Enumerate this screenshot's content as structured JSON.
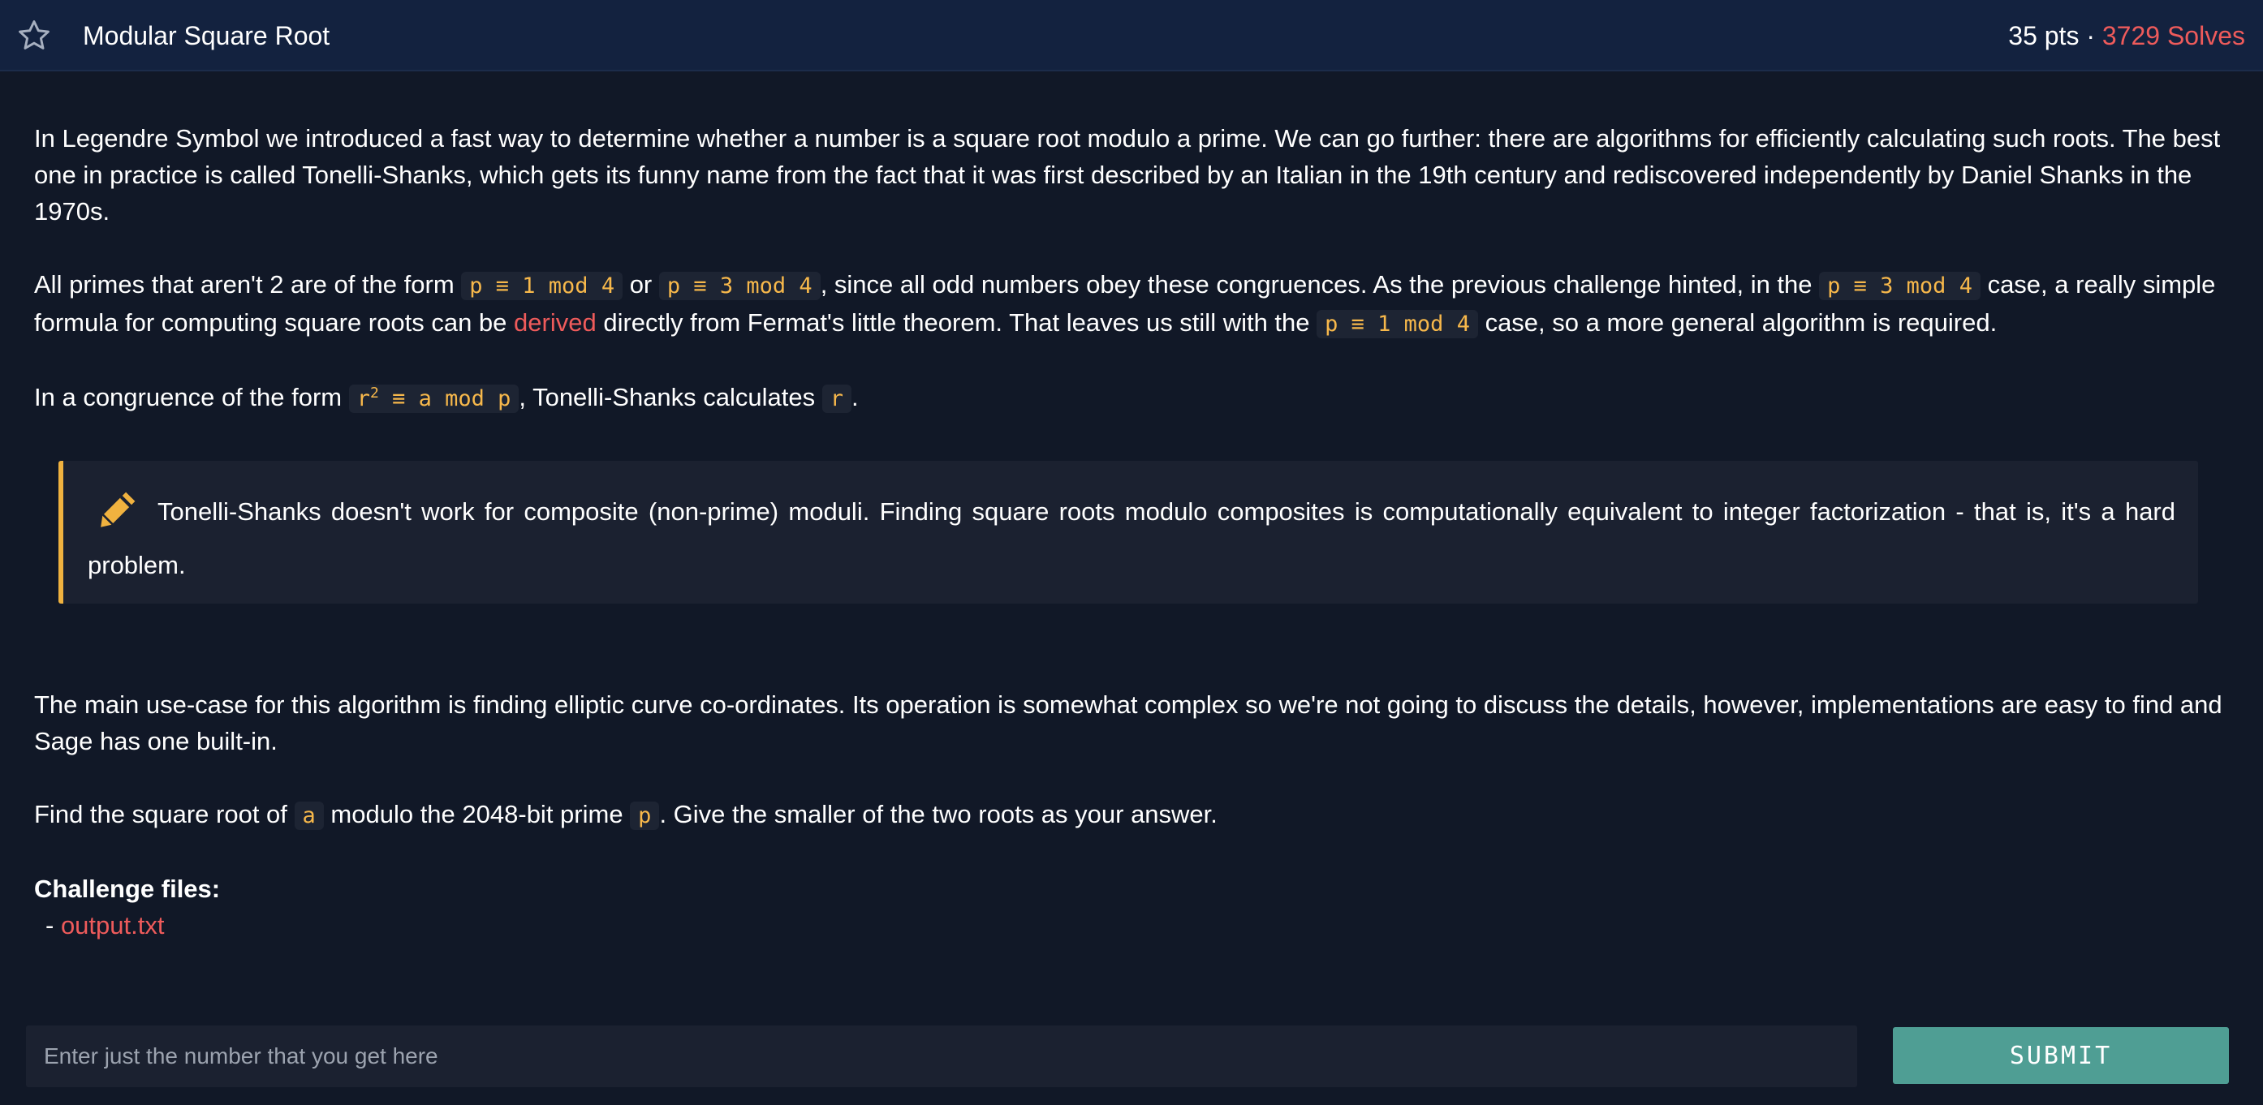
{
  "header": {
    "title": "Modular Square Root",
    "points": "35 pts",
    "separator": " · ",
    "solves": "3729 Solves"
  },
  "content": {
    "p1": "In Legendre Symbol we introduced a fast way to determine whether a number is a square root modulo a prime. We can go further: there are algorithms for efficiently calculating such roots. The best one in practice is called Tonelli-Shanks, which gets its funny name from the fact that it was first described by an Italian in the 19th century and rediscovered independently by Daniel Shanks in the 1970s.",
    "p2": {
      "t1": "All primes that aren't 2 are of the form ",
      "c1": "p ≡ 1 mod 4",
      "t2": " or ",
      "c2": "p ≡ 3 mod 4",
      "t3": ", since all odd numbers obey these congruences. As the previous challenge hinted, in the ",
      "c3": "p ≡ 3 mod 4",
      "t4": " case, a really simple formula for computing square roots can be ",
      "link": "derived",
      "t5": " directly from Fermat's little theorem. That leaves us still with the ",
      "c4": "p ≡ 1 mod 4",
      "t6": " case, so a more general algorithm is required."
    },
    "p3": {
      "t1": "In a congruence of the form ",
      "c1a": "r",
      "c1sup": "2",
      "c1b": " ≡ a mod p",
      "t2": ", Tonelli-Shanks calculates ",
      "c2": "r",
      "t3": "."
    },
    "note": "Tonelli-Shanks doesn't work for composite (non-prime) moduli. Finding square roots modulo composites is computationally equivalent to integer factorization - that is, it's a hard problem.",
    "p4": "The main use-case for this algorithm is finding elliptic curve co-ordinates. Its operation is somewhat complex so we're not going to discuss the details, however, implementations are easy to find and Sage has one built-in.",
    "p5": {
      "t1": "Find the square root of ",
      "c1": "a",
      "t2": " modulo the 2048-bit prime ",
      "c2": "p",
      "t3": ". Give the smaller of the two roots as your answer."
    },
    "files_label": "Challenge files:",
    "files": [
      {
        "bullet": "- ",
        "name": "output.txt"
      }
    ]
  },
  "form": {
    "placeholder": "Enter just the number that you get here",
    "submit_label": "SUBMIT"
  },
  "icons": {
    "star": "star-outline-icon",
    "pencil": "pencil-icon"
  },
  "colors": {
    "accent_red": "#ee5b5b",
    "code_yellow": "#f7b84b",
    "submit_teal": "#4f9e94",
    "note_border": "#f0b23f"
  }
}
